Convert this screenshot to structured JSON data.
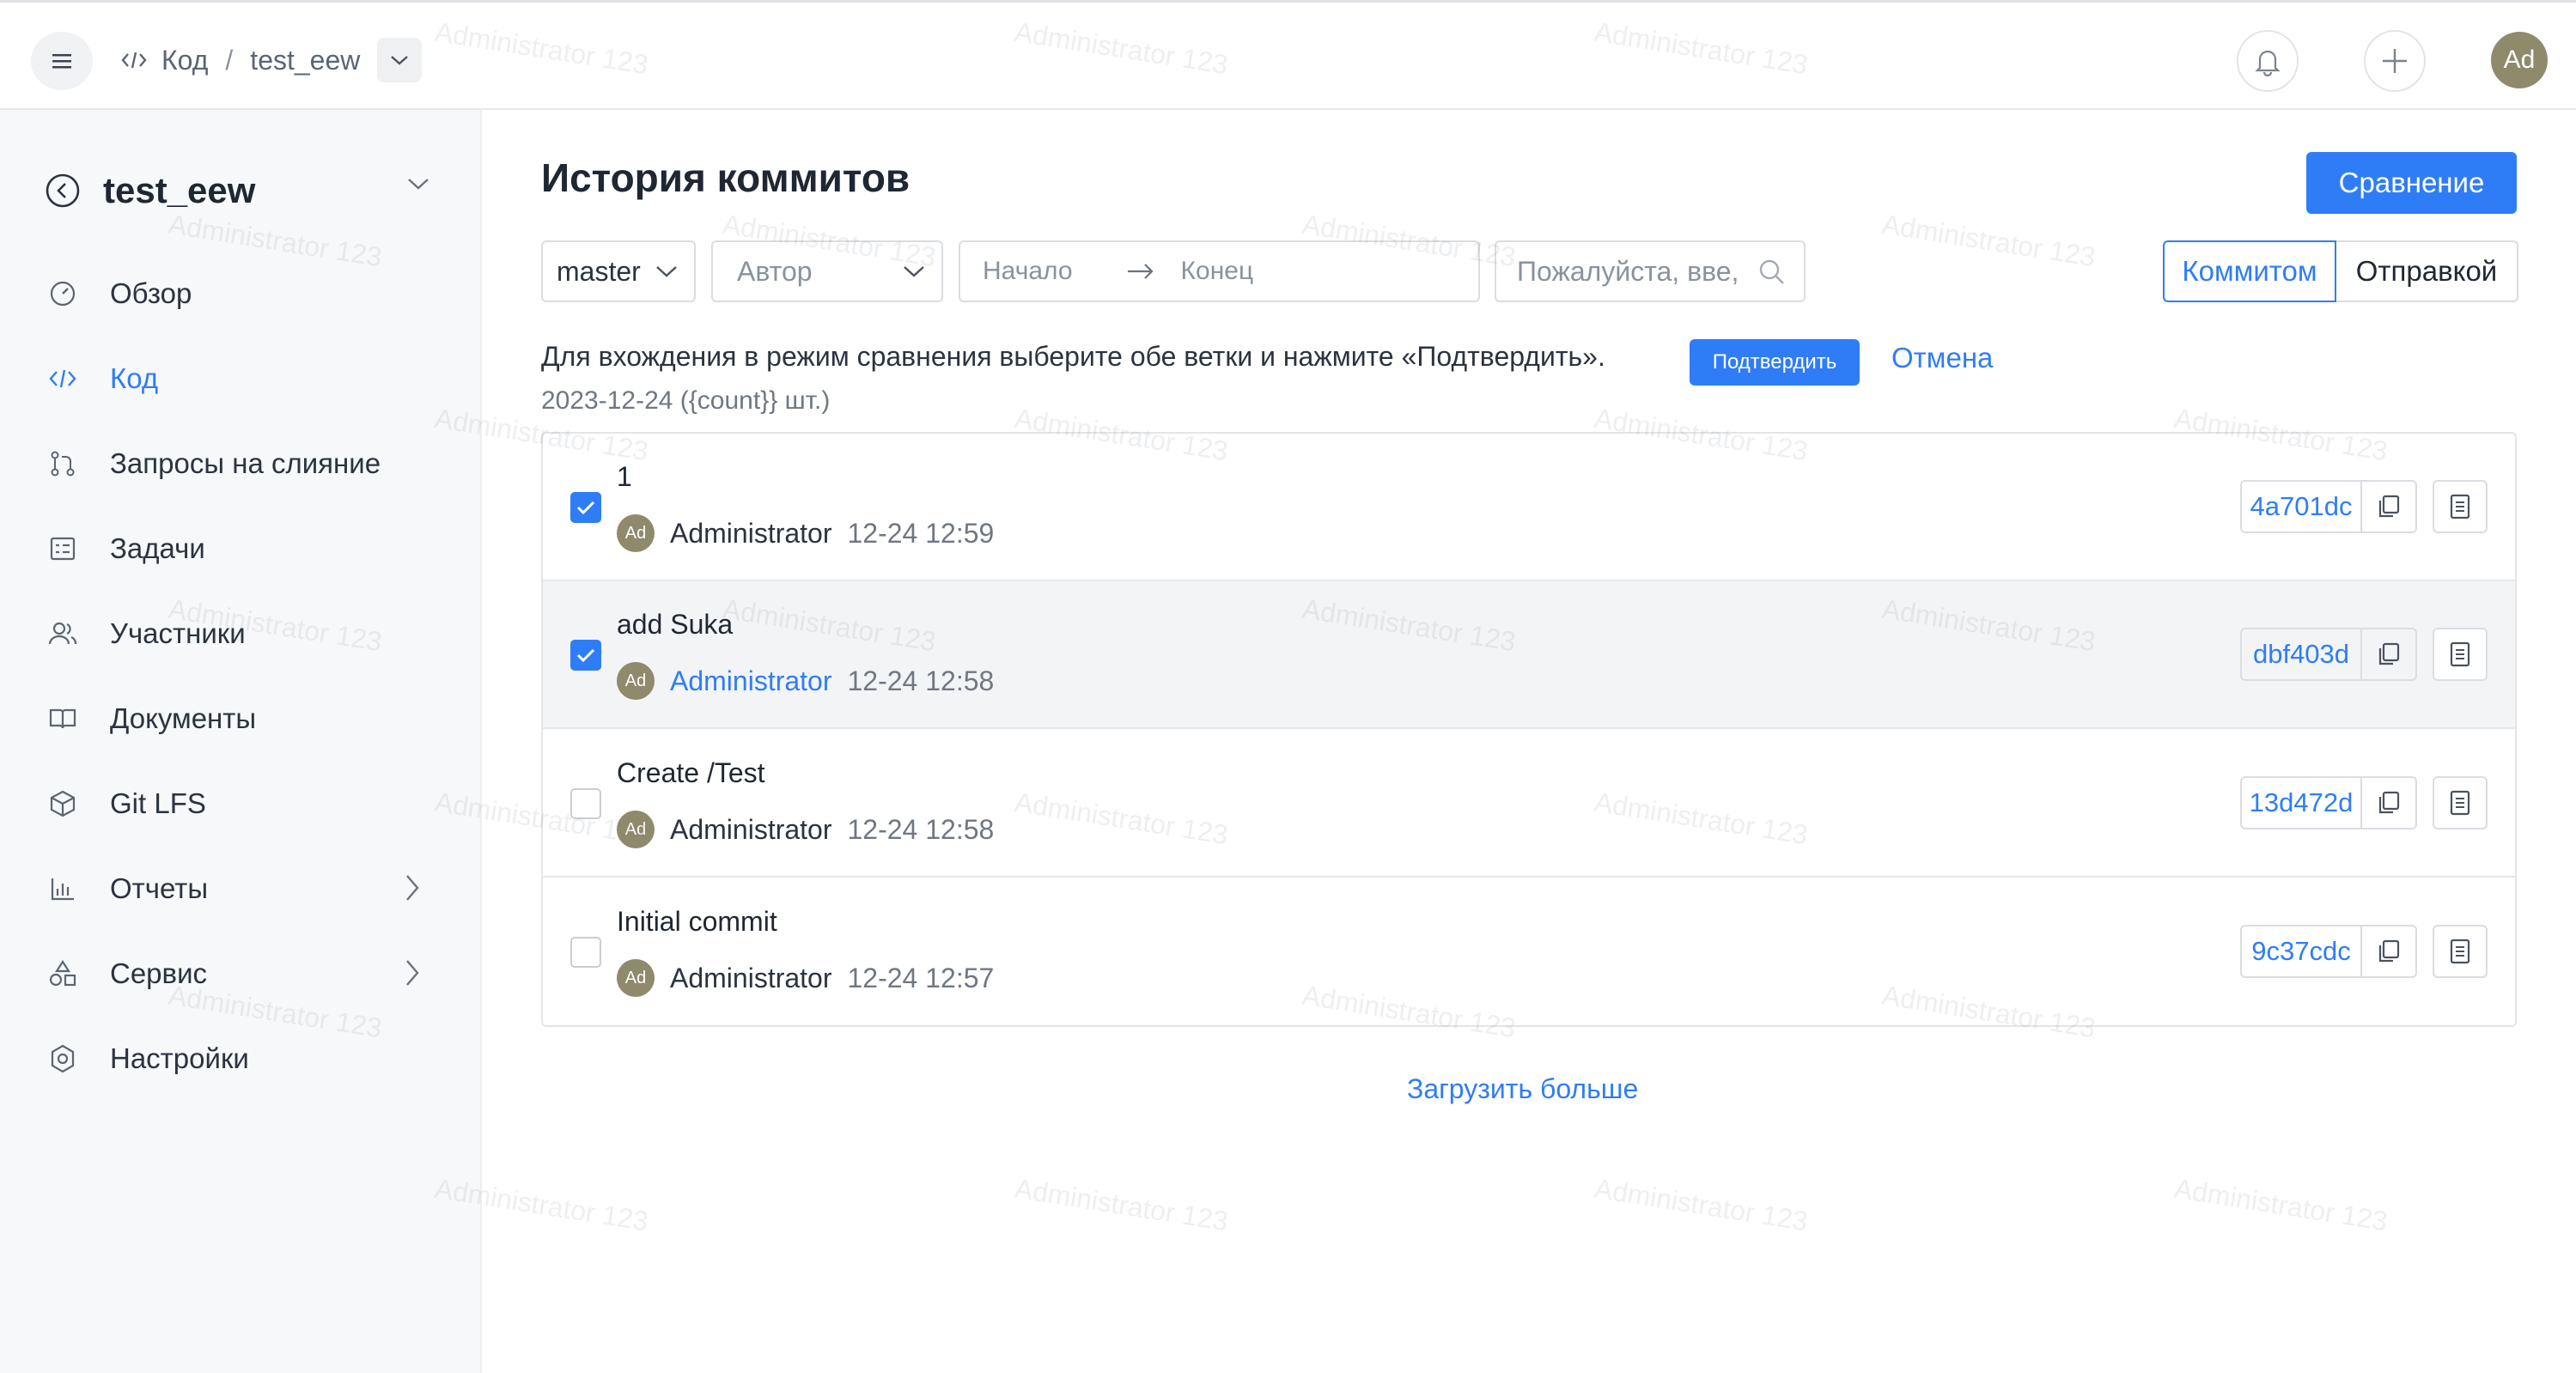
{
  "topbar": {
    "breadcrumb_section": "Код",
    "breadcrumb_sep": "/",
    "breadcrumb_repo": "test_eew",
    "avatar_initials": "Ad"
  },
  "sidebar": {
    "repo_name": "test_eew",
    "items": [
      {
        "label": "Обзор",
        "icon": "gauge-icon",
        "active": false
      },
      {
        "label": "Код",
        "icon": "code-icon",
        "active": true
      },
      {
        "label": "Запросы на слияние",
        "icon": "merge-request-icon",
        "active": false
      },
      {
        "label": "Задачи",
        "icon": "task-list-icon",
        "active": false
      },
      {
        "label": "Участники",
        "icon": "users-icon",
        "active": false
      },
      {
        "label": "Документы",
        "icon": "book-icon",
        "active": false
      },
      {
        "label": "Git LFS",
        "icon": "cube-icon",
        "active": false
      },
      {
        "label": "Отчеты",
        "icon": "bar-chart-icon",
        "active": false,
        "expandable": true
      },
      {
        "label": "Сервис",
        "icon": "shapes-icon",
        "active": false,
        "expandable": true
      },
      {
        "label": "Настройки",
        "icon": "gear-icon",
        "active": false
      }
    ]
  },
  "main": {
    "title": "История коммитов",
    "compare_button": "Сравнение",
    "filters": {
      "branch": "master",
      "author_placeholder": "Автор",
      "date_start_placeholder": "Начало",
      "date_end_placeholder": "Конец",
      "search_placeholder": "Пожалуйста, вве,"
    },
    "toggle": {
      "by_commit": "Коммитом",
      "by_push": "Отправкой",
      "selected": "by_commit"
    },
    "compare_hint": "Для вхождения в режим сравнения выберите обе ветки и нажмите «Подтвердить».",
    "confirm_button": "Подтвердить",
    "cancel_link": "Отмена",
    "group_date": "2023-12-24 ({count}} шт.)",
    "commits": [
      {
        "message": "1",
        "author": "Administrator",
        "avatar": "Ad",
        "time": "12-24 12:59",
        "sha": "4a701dc",
        "checked": true,
        "highlighted": false,
        "author_link": false
      },
      {
        "message": "add Suka",
        "author": "Administrator",
        "avatar": "Ad",
        "time": "12-24 12:58",
        "sha": "dbf403d",
        "checked": true,
        "highlighted": true,
        "author_link": true
      },
      {
        "message": "Create /Test",
        "author": "Administrator",
        "avatar": "Ad",
        "time": "12-24 12:58",
        "sha": "13d472d",
        "checked": false,
        "highlighted": false,
        "author_link": false
      },
      {
        "message": "Initial commit",
        "author": "Administrator",
        "avatar": "Ad",
        "time": "12-24 12:57",
        "sha": "9c37cdc",
        "checked": false,
        "highlighted": false,
        "author_link": false
      }
    ],
    "load_more": "Загрузить больше"
  },
  "watermark": "Administrator 123",
  "colors": {
    "accent": "#2f7df6",
    "avatar": "#8e8a6b",
    "sidebar_bg": "#f7f8f9"
  }
}
